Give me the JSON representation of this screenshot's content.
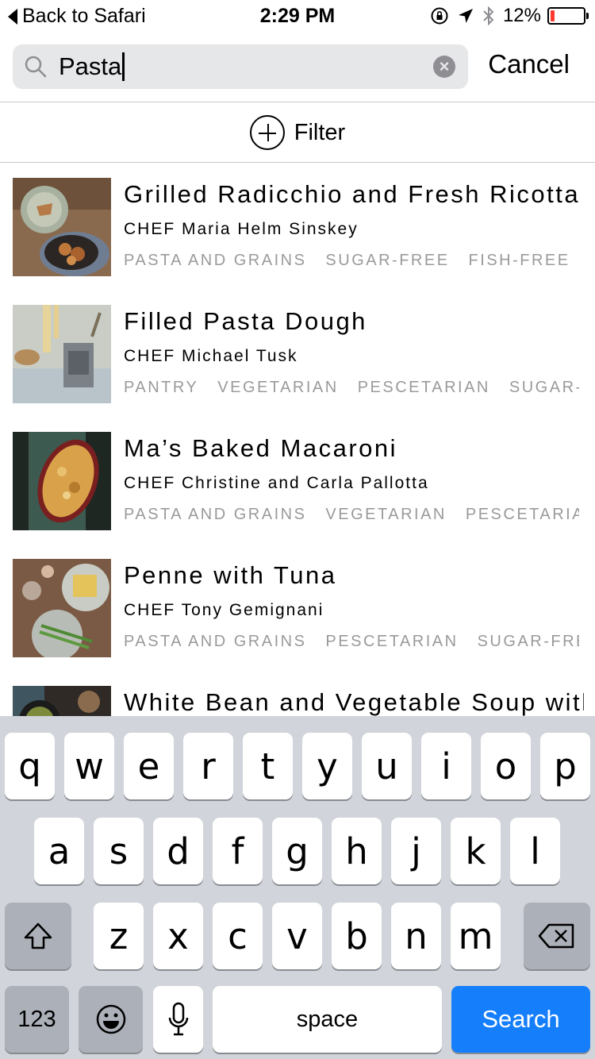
{
  "status_bar": {
    "back_label": "Back to Safari",
    "time": "2:29 PM",
    "battery_text": "12%",
    "battery_level": 0.12,
    "battery_color": "#ff3b30",
    "icons": [
      "orientation-lock-icon",
      "location-arrow-icon",
      "bluetooth-icon",
      "battery-icon"
    ]
  },
  "search": {
    "value": "Pasta",
    "cancel_label": "Cancel"
  },
  "filter": {
    "label": "Filter"
  },
  "results": [
    {
      "title": "Grilled Radicchio and Fresh Ricotta",
      "chef": "CHEF Maria Helm Sinskey",
      "tags": [
        "PASTA AND GRAINS",
        "SUGAR-FREE",
        "FISH-FREE"
      ]
    },
    {
      "title": "Filled Pasta Dough",
      "chef": "CHEF Michael Tusk",
      "tags": [
        "PANTRY",
        "VEGETARIAN",
        "PESCETARIAN",
        "SUGAR-FREE"
      ]
    },
    {
      "title": "Ma’s Baked Macaroni",
      "chef": "CHEF Christine and Carla Pallotta",
      "tags": [
        "PASTA AND GRAINS",
        "VEGETARIAN",
        "PESCETARIAN"
      ]
    },
    {
      "title": "Penne with Tuna",
      "chef": "CHEF Tony Gemignani",
      "tags": [
        "PASTA AND GRAINS",
        "PESCETARIAN",
        "SUGAR-FREE"
      ]
    },
    {
      "title": "White Bean and Vegetable Soup with",
      "chef": "",
      "tags": []
    }
  ],
  "keyboard": {
    "row1": [
      "q",
      "w",
      "e",
      "r",
      "t",
      "y",
      "u",
      "i",
      "o",
      "p"
    ],
    "row2": [
      "a",
      "s",
      "d",
      "f",
      "g",
      "h",
      "j",
      "k",
      "l"
    ],
    "row3": [
      "z",
      "x",
      "c",
      "v",
      "b",
      "n",
      "m"
    ],
    "numbers_label": "123",
    "space_label": "space",
    "search_label": "Search",
    "accent_color": "#147efb"
  }
}
